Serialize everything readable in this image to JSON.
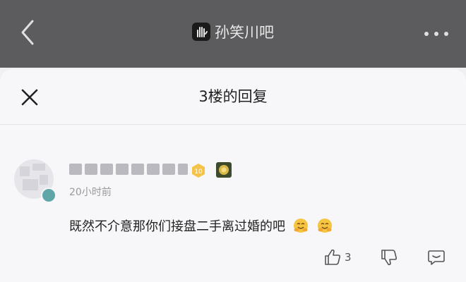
{
  "header": {
    "forum_name": "孙笑川吧",
    "back_icon": "chevron-left-icon",
    "more_icon": "more-dots-icon",
    "logo_icon": "forum-hand-logo-icon"
  },
  "sheet": {
    "title": "3楼的回复",
    "close_icon": "close-icon"
  },
  "reply": {
    "time": "20小时前",
    "level": "10",
    "text": "既然不介意那你们接盘二手离过婚的吧",
    "emoji_icon": "hug-emoji-icon",
    "like_count": "3"
  },
  "colors": {
    "header_bg": "#5c5c5e",
    "sheet_bg": "#f7f7f9",
    "level_badge": "#f4c44a",
    "emoji": "#f5c542"
  }
}
